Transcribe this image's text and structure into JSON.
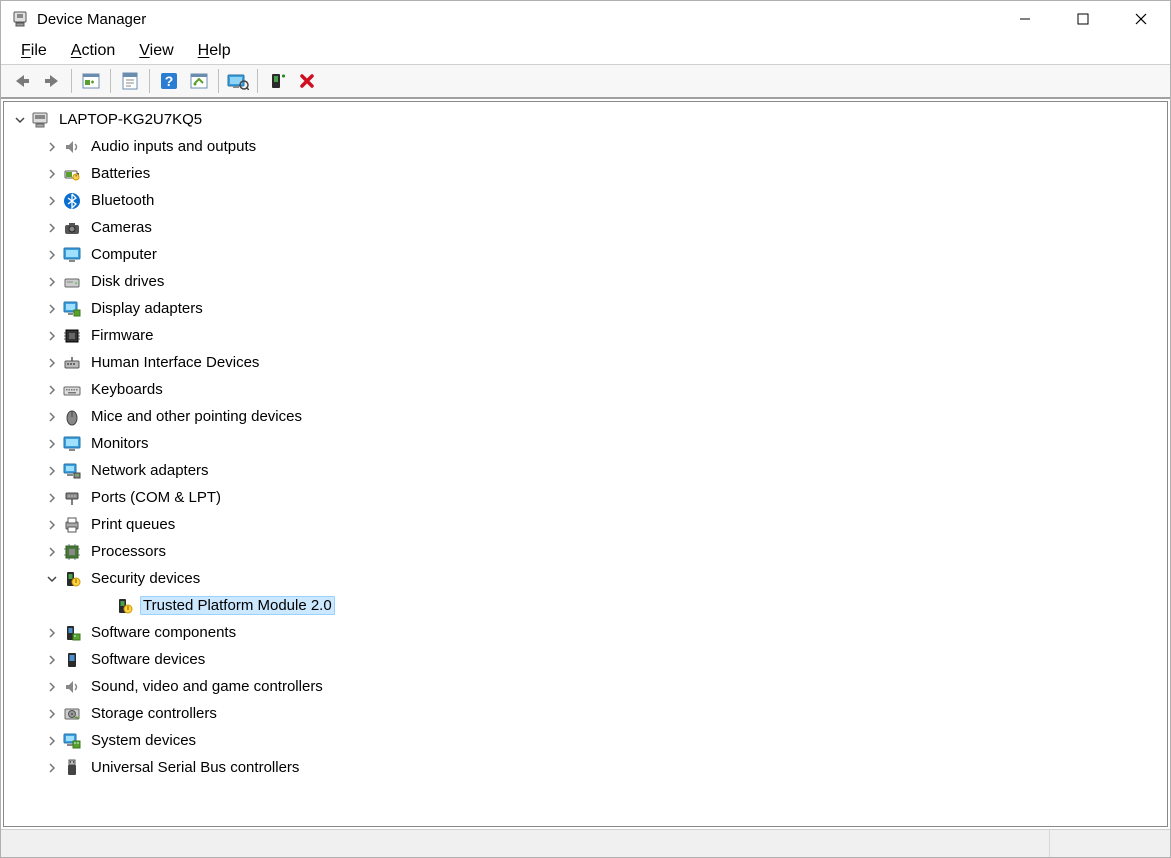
{
  "window": {
    "title": "Device Manager"
  },
  "menu": {
    "file": "File",
    "action": "Action",
    "view": "View",
    "help": "Help"
  },
  "toolbar": {
    "back": "Back",
    "forward": "Forward",
    "show_hide": "Show/Hide Console Tree",
    "properties": "Properties",
    "help": "Help",
    "update": "Update",
    "scan": "Scan for hardware changes",
    "add": "Add legacy hardware",
    "uninstall": "Uninstall device"
  },
  "tree": {
    "root": {
      "label": "LAPTOP-KG2U7KQ5",
      "icon": "computer-root",
      "expanded": true
    },
    "categories": [
      {
        "label": "Audio inputs and outputs",
        "icon": "audio",
        "expanded": false
      },
      {
        "label": "Batteries",
        "icon": "battery",
        "expanded": false
      },
      {
        "label": "Bluetooth",
        "icon": "bluetooth",
        "expanded": false
      },
      {
        "label": "Cameras",
        "icon": "camera",
        "expanded": false
      },
      {
        "label": "Computer",
        "icon": "monitor",
        "expanded": false
      },
      {
        "label": "Disk drives",
        "icon": "disk",
        "expanded": false
      },
      {
        "label": "Display adapters",
        "icon": "display-adapter",
        "expanded": false
      },
      {
        "label": "Firmware",
        "icon": "chip",
        "expanded": false
      },
      {
        "label": "Human Interface Devices",
        "icon": "hid",
        "expanded": false
      },
      {
        "label": "Keyboards",
        "icon": "keyboard",
        "expanded": false
      },
      {
        "label": "Mice and other pointing devices",
        "icon": "mouse",
        "expanded": false
      },
      {
        "label": "Monitors",
        "icon": "monitor",
        "expanded": false
      },
      {
        "label": "Network adapters",
        "icon": "network",
        "expanded": false
      },
      {
        "label": "Ports (COM & LPT)",
        "icon": "port",
        "expanded": false
      },
      {
        "label": "Print queues",
        "icon": "printer",
        "expanded": false
      },
      {
        "label": "Processors",
        "icon": "cpu",
        "expanded": false
      },
      {
        "label": "Security devices",
        "icon": "security",
        "expanded": true,
        "children": [
          {
            "label": "Trusted Platform Module 2.0",
            "icon": "security",
            "selected": true
          }
        ]
      },
      {
        "label": "Software components",
        "icon": "software-component",
        "expanded": false
      },
      {
        "label": "Software devices",
        "icon": "software-device",
        "expanded": false
      },
      {
        "label": "Sound, video and game controllers",
        "icon": "audio",
        "expanded": false
      },
      {
        "label": "Storage controllers",
        "icon": "storage",
        "expanded": false
      },
      {
        "label": "System devices",
        "icon": "system",
        "expanded": false
      },
      {
        "label": "Universal Serial Bus controllers",
        "icon": "usb",
        "expanded": false
      }
    ]
  }
}
